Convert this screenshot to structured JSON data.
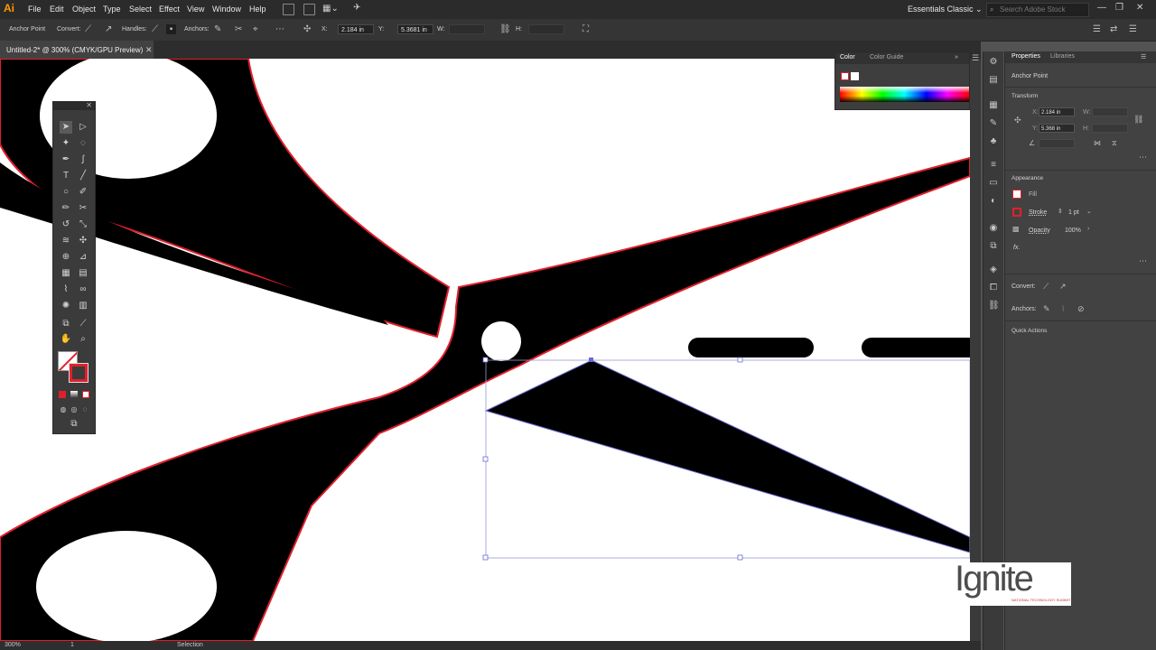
{
  "app": {
    "logo": "Ai"
  },
  "menubar": {
    "items": [
      "File",
      "Edit",
      "Object",
      "Type",
      "Select",
      "Effect",
      "View",
      "Window",
      "Help"
    ],
    "workspace": "Essentials Classic ⌄",
    "stock_search_placeholder": "Search Adobe Stock"
  },
  "controlbar": {
    "context_label": "Anchor Point",
    "convert_label": "Convert:",
    "handles_label": "Handles:",
    "anchors_label": "Anchors:",
    "x_label": "X:",
    "x_value": "2.184 in",
    "y_label": "Y:",
    "y_value": "5.3681 in",
    "w_label": "W:",
    "h_label": "H:"
  },
  "document": {
    "tab_title": "Untitled-2* @ 300% (CMYK/GPU Preview)"
  },
  "statusbar": {
    "zoom": "300%",
    "artboard": "1",
    "tool": "Selection"
  },
  "color_panel": {
    "tab_color": "Color",
    "tab_guide": "Color Guide"
  },
  "properties": {
    "tab_properties": "Properties",
    "tab_libraries": "Libraries",
    "selection_type": "Anchor Point",
    "transform_heading": "Transform",
    "x_label": "X:",
    "x_value": "2.184 in",
    "y_label": "Y:",
    "y_value": "5.368 in",
    "w_label": "W:",
    "h_label": "H:",
    "appearance_heading": "Appearance",
    "fill_label": "Fill",
    "stroke_label": "Stroke",
    "stroke_value": "1 pt",
    "opacity_label": "Opacity",
    "opacity_value": "100%",
    "fx_label": "fx.",
    "convert_label": "Convert:",
    "anchors_label": "Anchors:",
    "quick_actions_heading": "Quick Actions"
  },
  "watermark": {
    "word": "Ignite",
    "tagline": "NATIONAL TECHNOLOGY SUMMIT"
  },
  "colors": {
    "accent_stroke": "#e0202c",
    "selection": "#6a6ad0",
    "artwork": "#000000"
  }
}
